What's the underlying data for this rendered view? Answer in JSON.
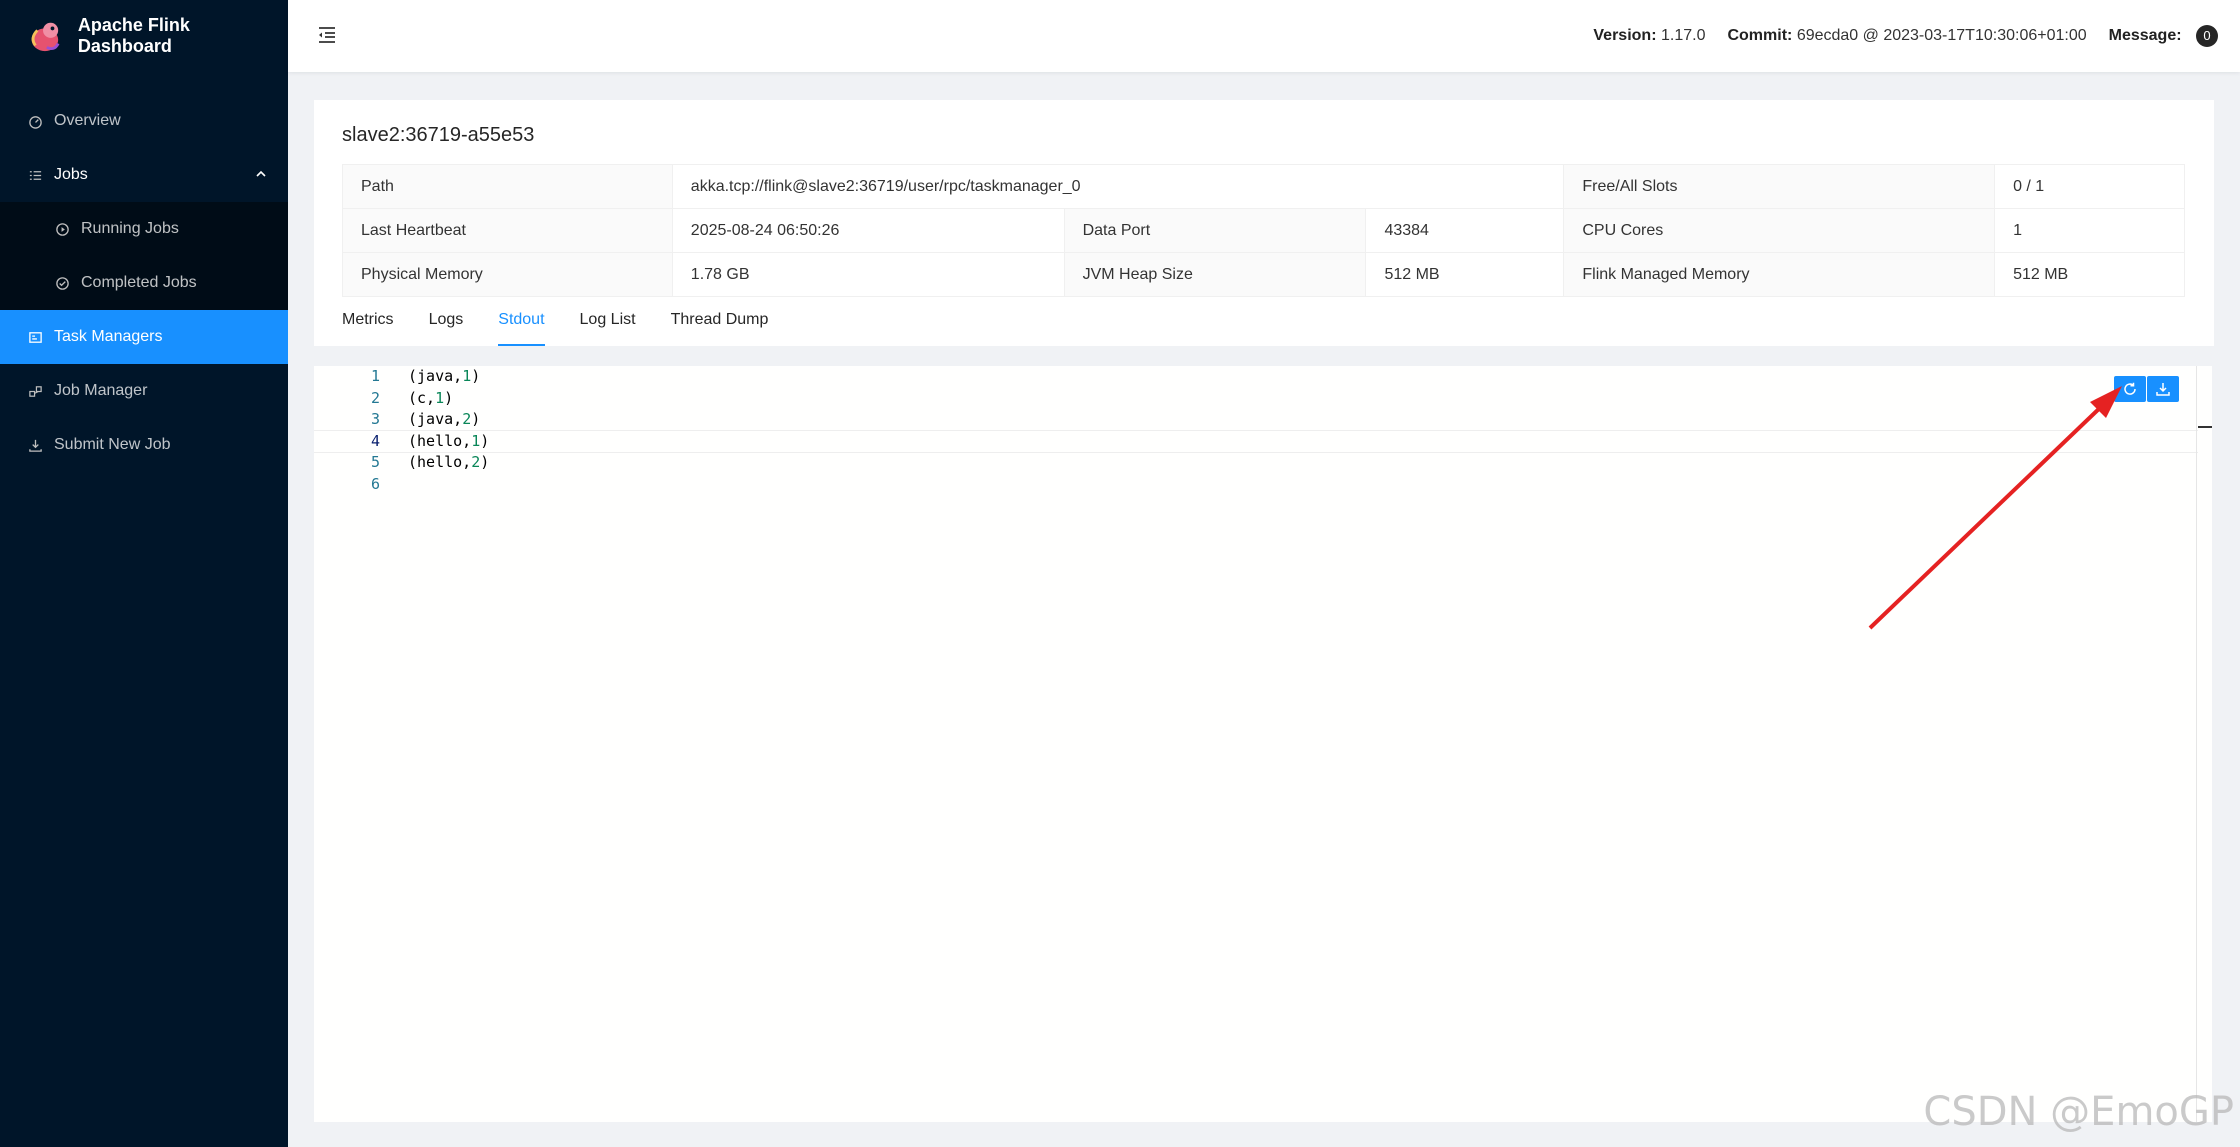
{
  "brand": {
    "title": "Apache Flink Dashboard"
  },
  "sidebar": {
    "items": [
      {
        "label": "Overview",
        "icon": "dashboard-icon"
      },
      {
        "label": "Jobs",
        "icon": "list-icon"
      },
      {
        "label": "Running Jobs",
        "icon": "play-circle-icon"
      },
      {
        "label": "Completed Jobs",
        "icon": "check-circle-icon"
      },
      {
        "label": "Task Managers",
        "icon": "schedule-icon"
      },
      {
        "label": "Job Manager",
        "icon": "cluster-icon"
      },
      {
        "label": "Submit New Job",
        "icon": "upload-icon"
      }
    ]
  },
  "header": {
    "version_label": "Version:",
    "version_value": "1.17.0",
    "commit_label": "Commit:",
    "commit_value": "69ecda0 @ 2023-03-17T10:30:06+01:00",
    "message_label": "Message:",
    "message_count": "0"
  },
  "taskmanager": {
    "title": "slave2:36719-a55e53",
    "rows": [
      [
        "Path",
        "akka.tcp://flink@slave2:36719/user/rpc/taskmanager_0",
        "Free/All Slots",
        "0 / 1"
      ],
      [
        "Last Heartbeat",
        "2025-08-24 06:50:26",
        "Data Port",
        "43384",
        "CPU Cores",
        "1"
      ],
      [
        "Physical Memory",
        "1.78 GB",
        "JVM Heap Size",
        "512 MB",
        "Flink Managed Memory",
        "512 MB"
      ]
    ]
  },
  "tabs": [
    {
      "label": "Metrics"
    },
    {
      "label": "Logs"
    },
    {
      "label": "Stdout",
      "active": true
    },
    {
      "label": "Log List"
    },
    {
      "label": "Thread Dump"
    }
  ],
  "editor": {
    "lines": [
      {
        "n": "1",
        "text": "(java,",
        "num": "1",
        "tail": ")"
      },
      {
        "n": "2",
        "text": "(c,",
        "num": "1",
        "tail": ")"
      },
      {
        "n": "3",
        "text": "(java,",
        "num": "2",
        "tail": ")"
      },
      {
        "n": "4",
        "text": "(hello,",
        "num": "1",
        "tail": ")"
      },
      {
        "n": "5",
        "text": "(hello,",
        "num": "2",
        "tail": ")"
      },
      {
        "n": "6",
        "text": "",
        "num": "",
        "tail": ""
      }
    ]
  },
  "watermark": "CSDN @EmoGP",
  "colors": {
    "primary": "#1890ff",
    "sidebar": "#001529",
    "annotation_arrow": "#e52222"
  }
}
